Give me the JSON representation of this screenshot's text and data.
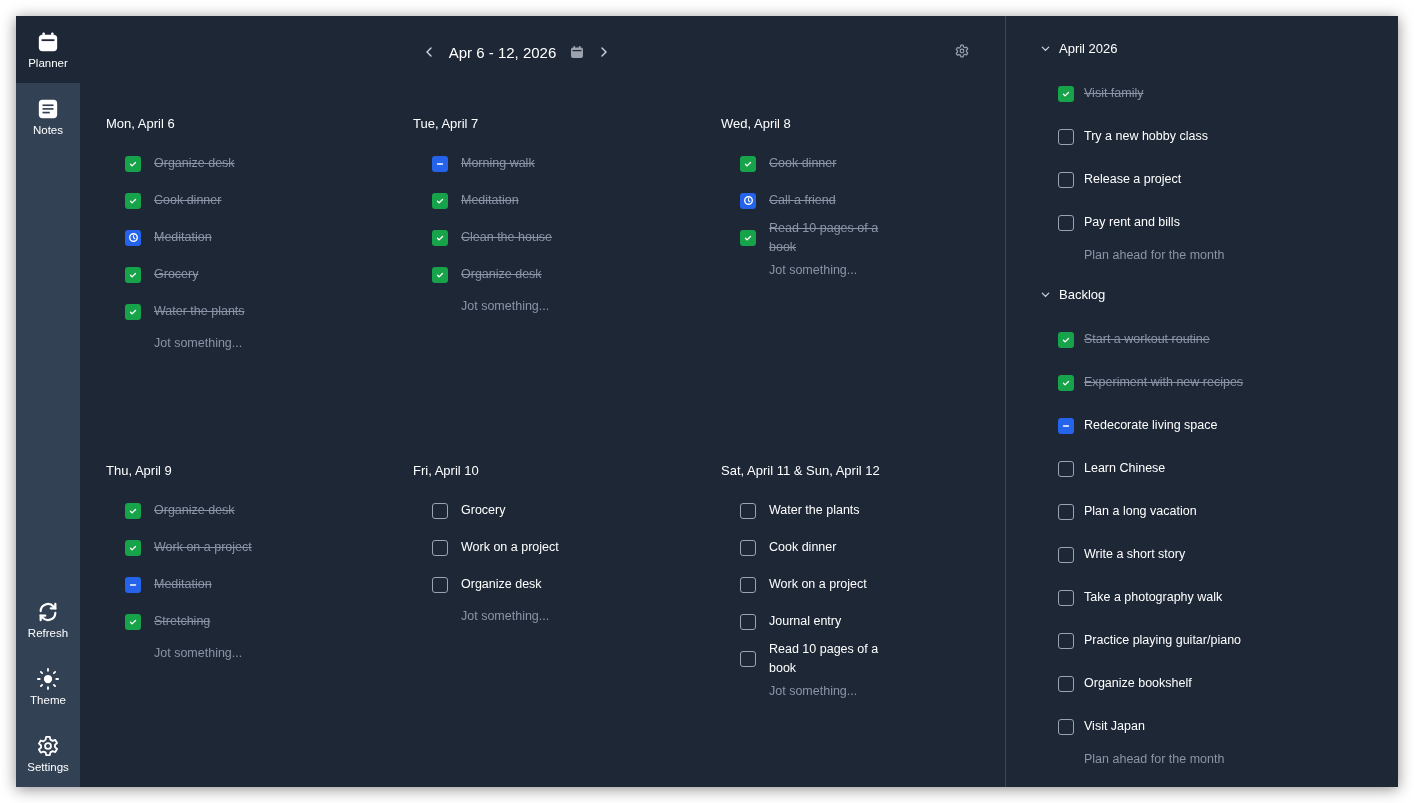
{
  "sidebar": {
    "nav": [
      {
        "label": "Planner",
        "selected": true
      },
      {
        "label": "Notes",
        "selected": false
      }
    ],
    "actions": [
      {
        "label": "Refresh"
      },
      {
        "label": "Theme"
      },
      {
        "label": "Settings"
      }
    ]
  },
  "header": {
    "range": "Apr 6 - 12, 2026"
  },
  "days": [
    {
      "title": "Mon, April 6",
      "placeholder": "Jot something...",
      "tasks": [
        {
          "text": "Organize desk",
          "kind": "done",
          "struck": true
        },
        {
          "text": "Cook dinner",
          "kind": "done",
          "struck": true
        },
        {
          "text": "Meditation",
          "kind": "delayed",
          "struck": true
        },
        {
          "text": "Grocery",
          "kind": "done",
          "struck": true
        },
        {
          "text": "Water the plants",
          "kind": "done",
          "struck": true
        }
      ]
    },
    {
      "title": "Tue, April 7",
      "placeholder": "Jot something...",
      "tasks": [
        {
          "text": "Morning walk",
          "kind": "cancelled",
          "struck": true
        },
        {
          "text": "Meditation",
          "kind": "done",
          "struck": true
        },
        {
          "text": "Clean the house",
          "kind": "done",
          "struck": true
        },
        {
          "text": "Organize desk",
          "kind": "done",
          "struck": true
        }
      ]
    },
    {
      "title": "Wed, April 8",
      "placeholder": "Jot something...",
      "tasks": [
        {
          "text": "Cook dinner",
          "kind": "done",
          "struck": true
        },
        {
          "text": "Call a friend",
          "kind": "delayed",
          "struck": true
        },
        {
          "text": "Read 10 pages of a book",
          "kind": "done",
          "struck": true
        }
      ]
    },
    {
      "title": "Thu, April 9",
      "placeholder": "Jot something...",
      "tasks": [
        {
          "text": "Organize desk",
          "kind": "done",
          "struck": true
        },
        {
          "text": "Work on a project",
          "kind": "done",
          "struck": true
        },
        {
          "text": "Meditation",
          "kind": "cancelled",
          "struck": true
        },
        {
          "text": "Stretching",
          "kind": "done",
          "struck": true
        }
      ]
    },
    {
      "title": "Fri, April 10",
      "placeholder": "Jot something...",
      "tasks": [
        {
          "text": "Grocery",
          "kind": "todo",
          "struck": false
        },
        {
          "text": "Work on a project",
          "kind": "todo",
          "struck": false
        },
        {
          "text": "Organize desk",
          "kind": "todo",
          "struck": false
        }
      ]
    },
    {
      "title": "Sat, April 11 & Sun, April 12",
      "placeholder": "Jot something...",
      "tasks": [
        {
          "text": "Water the plants",
          "kind": "todo",
          "struck": false
        },
        {
          "text": "Cook dinner",
          "kind": "todo",
          "struck": false
        },
        {
          "text": "Work on a project",
          "kind": "todo",
          "struck": false
        },
        {
          "text": "Journal entry",
          "kind": "todo",
          "struck": false
        },
        {
          "text": "Read 10 pages of a book",
          "kind": "todo",
          "struck": false
        }
      ]
    }
  ],
  "lists": [
    {
      "title": "April 2026",
      "expanded": true,
      "placeholder": "Plan ahead for the month",
      "tasks": [
        {
          "text": "Visit family",
          "kind": "done",
          "struck": true
        },
        {
          "text": "Try a new hobby class",
          "kind": "todo",
          "struck": false
        },
        {
          "text": "Release a project",
          "kind": "todo",
          "struck": false
        },
        {
          "text": "Pay rent and bills",
          "kind": "todo",
          "struck": false
        }
      ]
    },
    {
      "title": "Backlog",
      "expanded": true,
      "placeholder": "Plan ahead for the month",
      "tasks": [
        {
          "text": "Start a workout routine",
          "kind": "done",
          "struck": true
        },
        {
          "text": "Experiment with new recipes",
          "kind": "done",
          "struck": true
        },
        {
          "text": "Redecorate living space",
          "kind": "cancelled",
          "struck": false
        },
        {
          "text": "Learn Chinese",
          "kind": "todo",
          "struck": false
        },
        {
          "text": "Plan a long vacation",
          "kind": "todo",
          "struck": false
        },
        {
          "text": "Write a short story",
          "kind": "todo",
          "struck": false
        },
        {
          "text": "Take a photography walk",
          "kind": "todo",
          "struck": false
        },
        {
          "text": "Practice playing guitar/piano",
          "kind": "todo",
          "struck": false
        },
        {
          "text": "Organize bookshelf",
          "kind": "todo",
          "struck": false
        },
        {
          "text": "Visit Japan",
          "kind": "todo",
          "struck": false
        }
      ]
    }
  ]
}
